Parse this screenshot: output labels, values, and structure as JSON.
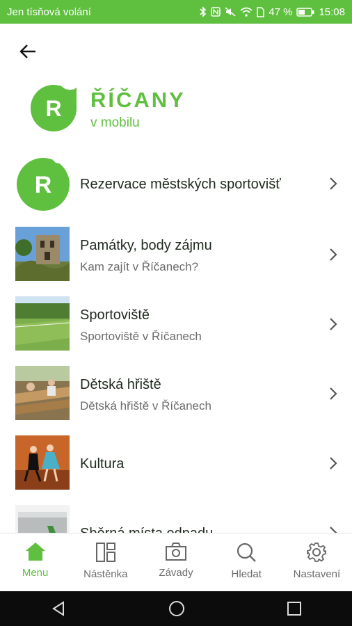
{
  "status": {
    "carrier": "Jen tísňová volání",
    "battery": "47 %",
    "time": "15:08"
  },
  "brand": {
    "letter": "R",
    "title": "ŘÍČANY",
    "subtitle": "v mobilu"
  },
  "menu": [
    {
      "title": "Rezervace městských sportovišť",
      "subtitle": "",
      "thumb": "logo-icon"
    },
    {
      "title": "Památky, body zájmu",
      "subtitle": "Kam zajít v Říčanech?",
      "thumb": "monument-thumbnail"
    },
    {
      "title": "Sportoviště",
      "subtitle": "Sportoviště v Říčanech",
      "thumb": "sports-field-thumbnail"
    },
    {
      "title": "Dětská hřiště",
      "subtitle": "Dětská hřiště v Říčanech",
      "thumb": "playground-thumbnail"
    },
    {
      "title": "Kultura",
      "subtitle": "",
      "thumb": "culture-thumbnail"
    },
    {
      "title": "Sběrná místa odpadu",
      "subtitle": "",
      "thumb": "waste-thumbnail"
    }
  ],
  "bottom_nav": [
    {
      "label": "Menu",
      "icon": "home-icon",
      "active": true
    },
    {
      "label": "Nástěnka",
      "icon": "board-icon",
      "active": false
    },
    {
      "label": "Závady",
      "icon": "camera-icon",
      "active": false
    },
    {
      "label": "Hledat",
      "icon": "search-icon",
      "active": false
    },
    {
      "label": "Nastavení",
      "icon": "gear-icon",
      "active": false
    }
  ],
  "colors": {
    "accent": "#5fbf3f",
    "text": "#1f2a1f",
    "muted": "#6b6b6b"
  }
}
